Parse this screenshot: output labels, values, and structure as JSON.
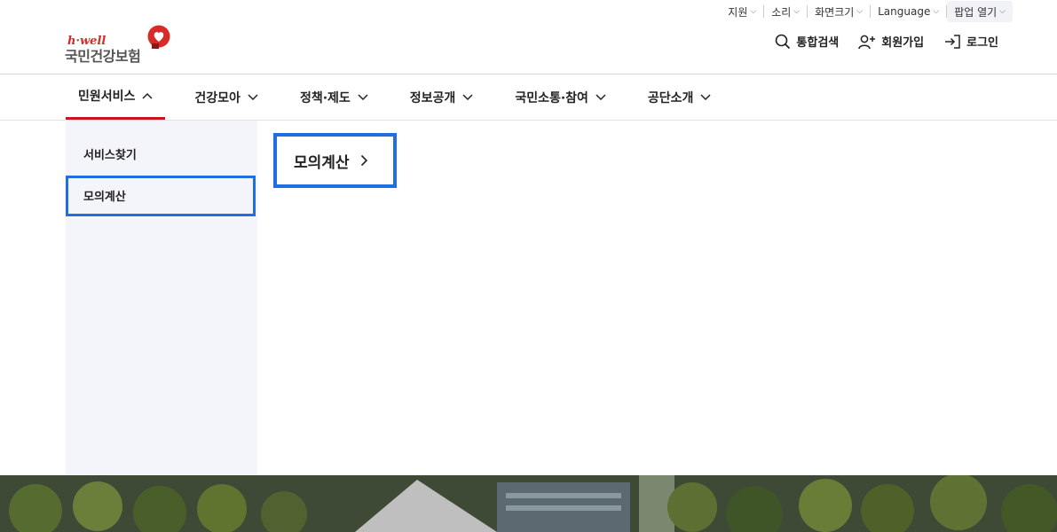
{
  "utility": {
    "support": "지원",
    "sound": "소리",
    "screen_size": "화면크기",
    "language": "Language",
    "popup": "팝업 열기"
  },
  "logo": {
    "brand": "h·well",
    "name": "국민건강보험"
  },
  "actions": {
    "search": "통합검색",
    "signup": "회원가입",
    "login": "로그인"
  },
  "gnb": {
    "items": [
      {
        "label": "민원서비스"
      },
      {
        "label": "건강모아"
      },
      {
        "label": "정책·제도"
      },
      {
        "label": "정보공개"
      },
      {
        "label": "국민소통·참여"
      },
      {
        "label": "공단소개"
      }
    ]
  },
  "megamenu": {
    "side_items": [
      {
        "label": "서비스찾기"
      },
      {
        "label": "모의계산"
      }
    ],
    "content_link": "모의계산"
  },
  "colors": {
    "accent_red": "#c8141e",
    "highlight_blue": "#1f6fe0",
    "menu_bg": "#f4f5fa"
  }
}
